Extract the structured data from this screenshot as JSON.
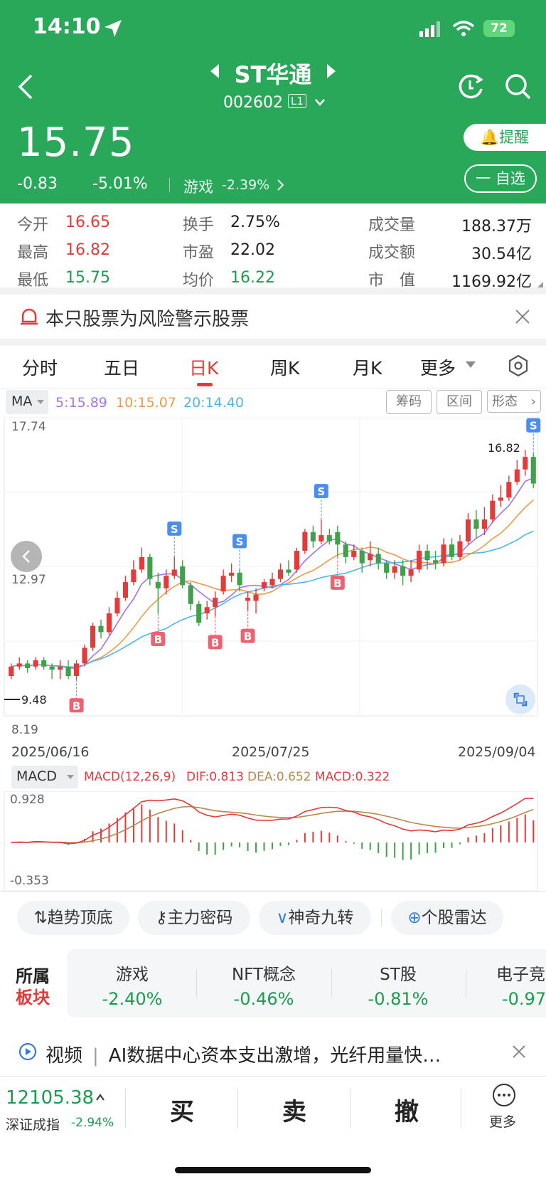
{
  "status": {
    "time": "14:10",
    "battery": "72"
  },
  "header": {
    "title": "ST华通",
    "code": "002602",
    "level": "L1",
    "price": "15.75",
    "change": "-0.83",
    "change_pct": "-5.01%",
    "sector_name": "游戏",
    "sector_pct": "-2.39%",
    "alert_label": "提醒",
    "watch_label": "一 自选"
  },
  "stats": {
    "open_label": "今开",
    "open": "16.65",
    "high_label": "最高",
    "high": "16.82",
    "low_label": "最低",
    "low": "15.75",
    "turnover_label": "换手",
    "turnover": "2.75%",
    "pe_label": "市盈",
    "pe": "22.02",
    "avg_label": "均价",
    "avg": "16.22",
    "volume_label": "成交量",
    "volume": "188.37万",
    "amount_label": "成交额",
    "amount": "30.54亿",
    "mcap_label": "市　值",
    "mcap": "1169.92亿"
  },
  "warning": {
    "text": "本只股票为风险警示股票"
  },
  "tabs": [
    {
      "label": "分时"
    },
    {
      "label": "五日"
    },
    {
      "label": "日K"
    },
    {
      "label": "周K"
    },
    {
      "label": "月K"
    },
    {
      "label": "更多"
    }
  ],
  "chart_buttons": {
    "chips": "筹码",
    "range": "区间",
    "pattern": "形态"
  },
  "ma": {
    "label": "MA",
    "ma5": "5:15.89",
    "ma10": "10:15.07",
    "ma20": "20:14.40"
  },
  "colors": {
    "up": "#e23b3b",
    "down": "#3fa24a",
    "ma5": "#a675e0",
    "ma10": "#f29a4a",
    "ma20": "#4eb7ea",
    "header": "#2aa85a"
  },
  "chart_data": {
    "type": "candlestick",
    "ylim": [
      8.19,
      17.74
    ],
    "y_ticks": [
      "17.74",
      "12.97",
      "8.19"
    ],
    "x_labels": [
      "2025/06/16",
      "2025/07/25",
      "2025/09/04"
    ],
    "annotations": {
      "max_label": "16.82",
      "min_label": "9.48"
    },
    "candles": [
      {
        "o": 9.6,
        "c": 9.9,
        "h": 10.0,
        "l": 9.5
      },
      {
        "o": 9.9,
        "c": 10.0,
        "h": 10.2,
        "l": 9.8
      },
      {
        "o": 10.0,
        "c": 9.85,
        "h": 10.1,
        "l": 9.7
      },
      {
        "o": 9.9,
        "c": 10.1,
        "h": 10.2,
        "l": 9.8
      },
      {
        "o": 10.1,
        "c": 9.9,
        "h": 10.2,
        "l": 9.8
      },
      {
        "o": 9.9,
        "c": 9.8,
        "h": 10.0,
        "l": 9.5
      },
      {
        "o": 9.8,
        "c": 9.9,
        "h": 10.1,
        "l": 9.5
      },
      {
        "o": 9.9,
        "c": 9.6,
        "h": 10.1,
        "l": 9.5
      },
      {
        "o": 9.6,
        "c": 10.0,
        "h": 10.1,
        "l": 9.48
      },
      {
        "o": 10.0,
        "c": 10.5,
        "h": 10.6,
        "l": 9.9
      },
      {
        "o": 10.5,
        "c": 11.2,
        "h": 11.3,
        "l": 10.4
      },
      {
        "o": 11.2,
        "c": 11.0,
        "h": 11.4,
        "l": 10.8
      },
      {
        "o": 11.0,
        "c": 11.6,
        "h": 11.8,
        "l": 10.9
      },
      {
        "o": 11.6,
        "c": 12.1,
        "h": 12.3,
        "l": 11.5
      },
      {
        "o": 12.1,
        "c": 12.6,
        "h": 12.8,
        "l": 12.0
      },
      {
        "o": 12.6,
        "c": 13.0,
        "h": 13.3,
        "l": 12.5
      },
      {
        "o": 13.0,
        "c": 13.4,
        "h": 13.7,
        "l": 12.9
      },
      {
        "o": 13.4,
        "c": 12.7,
        "h": 13.5,
        "l": 12.5
      },
      {
        "o": 12.6,
        "c": 12.4,
        "h": 12.9,
        "l": 11.6
      },
      {
        "o": 12.4,
        "c": 12.8,
        "h": 13.0,
        "l": 12.2
      },
      {
        "o": 12.8,
        "c": 13.0,
        "h": 13.4,
        "l": 12.7
      },
      {
        "o": 13.1,
        "c": 12.5,
        "h": 13.3,
        "l": 12.4
      },
      {
        "o": 12.5,
        "c": 11.9,
        "h": 12.6,
        "l": 11.7
      },
      {
        "o": 11.9,
        "c": 11.3,
        "h": 12.0,
        "l": 11.2
      },
      {
        "o": 11.6,
        "c": 11.8,
        "h": 12.0,
        "l": 11.4
      },
      {
        "o": 11.8,
        "c": 12.1,
        "h": 12.3,
        "l": 11.5
      },
      {
        "o": 12.3,
        "c": 12.8,
        "h": 13.0,
        "l": 12.2
      },
      {
        "o": 12.8,
        "c": 12.9,
        "h": 13.2,
        "l": 12.6
      },
      {
        "o": 12.9,
        "c": 12.5,
        "h": 13.0,
        "l": 12.3
      },
      {
        "o": 12.0,
        "c": 12.1,
        "h": 12.3,
        "l": 11.7
      },
      {
        "o": 12.0,
        "c": 12.2,
        "h": 12.4,
        "l": 11.6
      },
      {
        "o": 12.4,
        "c": 12.6,
        "h": 12.7,
        "l": 12.3
      },
      {
        "o": 12.5,
        "c": 12.7,
        "h": 12.9,
        "l": 12.4
      },
      {
        "o": 12.7,
        "c": 13.0,
        "h": 13.2,
        "l": 12.6
      },
      {
        "o": 13.0,
        "c": 12.9,
        "h": 13.3,
        "l": 12.8
      },
      {
        "o": 13.0,
        "c": 13.6,
        "h": 13.7,
        "l": 12.9
      },
      {
        "o": 13.6,
        "c": 14.2,
        "h": 14.3,
        "l": 13.5
      },
      {
        "o": 14.2,
        "c": 13.9,
        "h": 14.4,
        "l": 13.7
      },
      {
        "o": 13.9,
        "c": 14.1,
        "h": 14.6,
        "l": 13.8
      },
      {
        "o": 14.1,
        "c": 13.9,
        "h": 14.3,
        "l": 13.8
      },
      {
        "o": 14.2,
        "c": 13.8,
        "h": 14.4,
        "l": 13.4
      },
      {
        "o": 13.8,
        "c": 13.4,
        "h": 13.9,
        "l": 13.2
      },
      {
        "o": 13.4,
        "c": 13.6,
        "h": 13.8,
        "l": 13.3
      },
      {
        "o": 13.6,
        "c": 13.2,
        "h": 13.7,
        "l": 12.9
      },
      {
        "o": 13.3,
        "c": 13.5,
        "h": 13.9,
        "l": 13.1
      },
      {
        "o": 13.5,
        "c": 13.2,
        "h": 13.7,
        "l": 13.0
      },
      {
        "o": 13.2,
        "c": 12.9,
        "h": 13.3,
        "l": 12.7
      },
      {
        "o": 12.9,
        "c": 13.1,
        "h": 13.3,
        "l": 12.7
      },
      {
        "o": 13.1,
        "c": 12.8,
        "h": 13.3,
        "l": 12.5
      },
      {
        "o": 12.8,
        "c": 13.0,
        "h": 13.3,
        "l": 12.6
      },
      {
        "o": 13.0,
        "c": 13.6,
        "h": 13.8,
        "l": 12.9
      },
      {
        "o": 13.6,
        "c": 13.3,
        "h": 13.8,
        "l": 13.0
      },
      {
        "o": 13.3,
        "c": 13.2,
        "h": 13.6,
        "l": 13.0
      },
      {
        "o": 13.2,
        "c": 13.8,
        "h": 14.0,
        "l": 13.1
      },
      {
        "o": 13.8,
        "c": 13.4,
        "h": 14.0,
        "l": 13.3
      },
      {
        "o": 13.4,
        "c": 13.9,
        "h": 14.1,
        "l": 13.3
      },
      {
        "o": 13.9,
        "c": 14.6,
        "h": 14.8,
        "l": 13.8
      },
      {
        "o": 14.6,
        "c": 14.3,
        "h": 14.9,
        "l": 14.0
      },
      {
        "o": 14.3,
        "c": 14.6,
        "h": 15.0,
        "l": 14.1
      },
      {
        "o": 14.6,
        "c": 15.2,
        "h": 15.4,
        "l": 14.5
      },
      {
        "o": 15.2,
        "c": 15.3,
        "h": 15.7,
        "l": 15.0
      },
      {
        "o": 15.3,
        "c": 15.8,
        "h": 16.0,
        "l": 15.2
      },
      {
        "o": 15.8,
        "c": 16.2,
        "h": 16.5,
        "l": 15.7
      },
      {
        "o": 16.2,
        "c": 16.6,
        "h": 16.82,
        "l": 16.0
      },
      {
        "o": 16.6,
        "c": 15.75,
        "h": 16.7,
        "l": 15.6
      }
    ],
    "markers": [
      {
        "i": 8,
        "label": "B"
      },
      {
        "i": 18,
        "label": "B"
      },
      {
        "i": 25,
        "label": "B"
      },
      {
        "i": 29,
        "label": "B"
      },
      {
        "i": 40,
        "label": "B"
      },
      {
        "i": 20,
        "label": "S"
      },
      {
        "i": 28,
        "label": "S"
      },
      {
        "i": 38,
        "label": "S"
      },
      {
        "i": 64,
        "label": "S"
      }
    ],
    "macd": {
      "label": "MACD",
      "params": "MACD(12,26,9)",
      "dif": "DIF:0.813",
      "dea": "DEA:0.652",
      "value": "MACD:0.322",
      "y_ticks": [
        "0.928",
        "-0.353"
      ]
    }
  },
  "tools": [
    {
      "label": "趋势顶底"
    },
    {
      "label": "主力密码"
    },
    {
      "label": "神奇九转"
    },
    {
      "label": "个股雷达"
    }
  ],
  "sectors": {
    "title1": "所属",
    "title2": "板块",
    "items": [
      {
        "name": "游戏",
        "pct": "-2.40%"
      },
      {
        "name": "NFT概念",
        "pct": "-0.46%"
      },
      {
        "name": "ST股",
        "pct": "-0.81%"
      },
      {
        "name": "电子竞",
        "pct": "-0.97"
      }
    ]
  },
  "news": {
    "tag": "视频",
    "text": "AI数据中心资本支出激增，光纤用量快…"
  },
  "bottom": {
    "index_value": "12105.38",
    "index_name": "深证成指",
    "index_pct": "-2.94%",
    "buy": "买",
    "sell": "卖",
    "cancel": "撤",
    "more": "更多"
  }
}
